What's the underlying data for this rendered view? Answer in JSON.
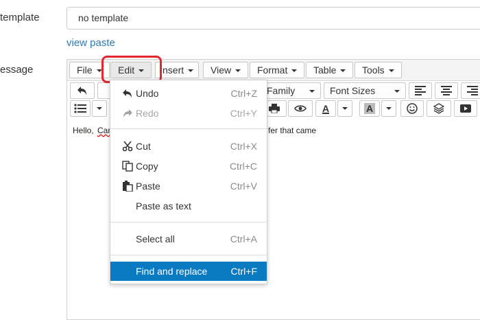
{
  "labels": {
    "template": "template",
    "message": "essage"
  },
  "template_field": {
    "value": "no template"
  },
  "links": {
    "view_paste": "view paste"
  },
  "menubar": {
    "items": [
      {
        "label": "File"
      },
      {
        "label": "Edit"
      },
      {
        "label": "nsert"
      },
      {
        "label": "View"
      },
      {
        "label": "Format"
      },
      {
        "label": "Table"
      },
      {
        "label": "Tools"
      }
    ]
  },
  "toolbar": {
    "font_family": "Family",
    "font_sizes": "Font Sizes",
    "text_color_letter": "A",
    "bg_color_letter": "A"
  },
  "content": {
    "part1": "Hello,",
    "part2": "Can",
    "part3": "fer that came"
  },
  "dropdown": {
    "undo": {
      "label": "Undo",
      "shortcut": "Ctrl+Z"
    },
    "redo": {
      "label": "Redo",
      "shortcut": "Ctrl+Y"
    },
    "cut": {
      "label": "Cut",
      "shortcut": "Ctrl+X"
    },
    "copy": {
      "label": "Copy",
      "shortcut": "Ctrl+C"
    },
    "paste": {
      "label": "Paste",
      "shortcut": "Ctrl+V"
    },
    "paste_text": {
      "label": "Paste as text"
    },
    "select_all": {
      "label": "Select all",
      "shortcut": "Ctrl+A"
    },
    "find_replace": {
      "label": "Find and replace",
      "shortcut": "Ctrl+F"
    }
  },
  "colors": {
    "highlight": "#e2272f",
    "active_item": "#0a7bc2",
    "link": "#2a7ab8"
  }
}
